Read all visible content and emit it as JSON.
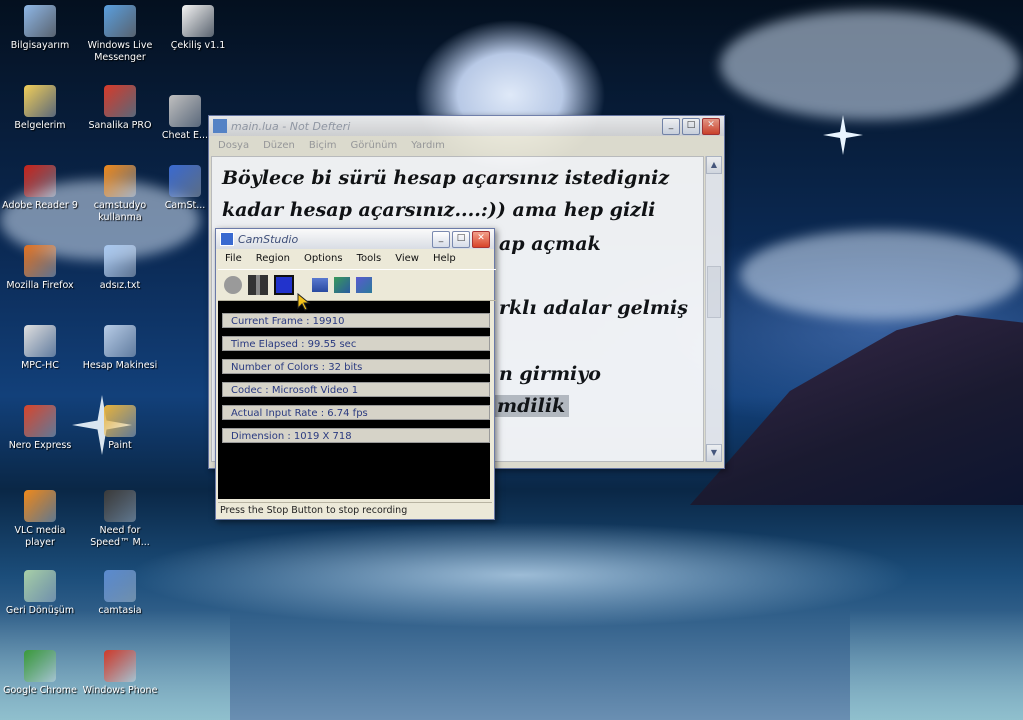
{
  "desktop_icons": [
    {
      "label": "Bilgisayarım",
      "icon": "computer-icon",
      "color": "#8fb8e8"
    },
    {
      "label": "Windows Live Messenger",
      "icon": "messenger-icon",
      "color": "#5aa0e0"
    },
    {
      "label": "Çekiliş v1.1",
      "icon": "window-app-icon",
      "color": "#f4f4f4"
    },
    {
      "label": "Belgelerim",
      "icon": "folder-icon",
      "color": "#f2cf5a"
    },
    {
      "label": "Sanalika PRO",
      "icon": "game-icon",
      "color": "#d83a2a"
    },
    {
      "label": "Cheat E...",
      "icon": "cheat-engine-icon",
      "color": "#c0c0c0"
    },
    {
      "label": "Adobe Reader 9",
      "icon": "pdf-icon",
      "color": "#c8221a"
    },
    {
      "label": "camstudyo kullanma",
      "icon": "vlc-cone-icon",
      "color": "#f08a1c"
    },
    {
      "label": "CamSt...",
      "icon": "camstudio-icon",
      "color": "#3a6ad0"
    },
    {
      "label": "Mozilla Firefox",
      "icon": "firefox-icon",
      "color": "#e2701e"
    },
    {
      "label": "adsız.txt",
      "icon": "text-file-icon",
      "color": "#a8c8f0"
    },
    {
      "label": "MPC-HC",
      "icon": "media-player-icon",
      "color": "#e0e0e0"
    },
    {
      "label": "Hesap Makinesi",
      "icon": "calculator-icon",
      "color": "#b8cde8"
    },
    {
      "label": "Nero Express",
      "icon": "nero-icon",
      "color": "#d8442a"
    },
    {
      "label": "Paint",
      "icon": "paint-icon",
      "color": "#e8b23a"
    },
    {
      "label": "VLC media player",
      "icon": "vlc-icon",
      "color": "#f08a1c"
    },
    {
      "label": "Need for Speed™ M...",
      "icon": "nfs-icon",
      "color": "#3a3a3a"
    },
    {
      "label": "Geri Dönüşüm",
      "icon": "recycle-bin-icon",
      "color": "#a8d0a8"
    },
    {
      "label": "camtasia",
      "icon": "camtasia-icon",
      "color": "#5a8ad0"
    },
    {
      "label": "Google Chrome",
      "icon": "chrome-icon",
      "color": "#3a9a3a"
    },
    {
      "label": "Windows Phone",
      "icon": "phone-icon",
      "color": "#d03a2a"
    }
  ],
  "notepad": {
    "title": "main.lua - Not Defteri",
    "menu": [
      "Dosya",
      "Düzen",
      "Biçim",
      "Görünüm",
      "Yardım"
    ],
    "lines": [
      "Böylece bi sürü hesap açarsınız istedigniz",
      "kadar hesap açarsınız....:)) ama hep gizli",
      "ap açmak",
      "rklı adalar gelmiş",
      "n girmiyo",
      "mdilik"
    ],
    "minimize": "_",
    "maximize": "□",
    "close": "✕"
  },
  "camstudio": {
    "title": "CamStudio",
    "menu": [
      "File",
      "Region",
      "Options",
      "Tools",
      "View",
      "Help"
    ],
    "stats": [
      "Current Frame : 19910",
      "Time Elapsed : 99.55 sec",
      "Number of Colors : 32 bits",
      "Codec : Microsoft Video 1",
      "Actual Input Rate : 6.74 fps",
      "Dimension : 1019 X 718"
    ],
    "status": "Press the Stop Button to stop recording",
    "minimize": "_",
    "maximize": "□",
    "close": "✕",
    "colors": {
      "record": "#9a9a9a",
      "stop": "#2233cc",
      "pause": "#333333"
    }
  }
}
